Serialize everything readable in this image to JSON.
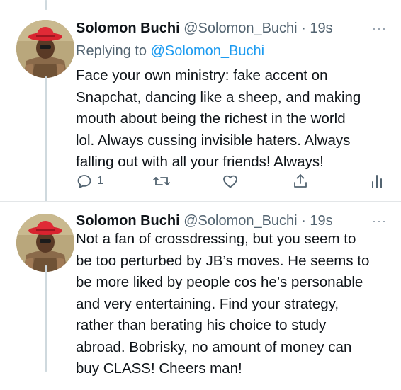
{
  "tweets": [
    {
      "author": {
        "name": "Solomon Buchi",
        "handle": "@Solomon_Buchi",
        "avatar_icon": "profile-avatar"
      },
      "separator": "·",
      "time": "19s",
      "more_icon": "more-icon",
      "replying_prefix": "Replying to",
      "replying_to": "@Solomon_Buchi",
      "text": "Face your own ministry: fake accent on\nSnapchat, dancing like a sheep, and making\nmouth about being the richest in the world\nlol. Always cussing invisible haters. Always\nfalling out with all your friends! Always!",
      "actions": {
        "reply_count": "1",
        "retweet_count": "",
        "like_count": ""
      }
    },
    {
      "author": {
        "name": "Solomon Buchi",
        "handle": "@Solomon_Buchi",
        "avatar_icon": "profile-avatar"
      },
      "separator": "·",
      "time": "19s",
      "more_icon": "more-icon",
      "text": "Not a fan of crossdressing, but you seem to\nbe too perturbed by JB’s moves. He seems to\nbe more liked by people cos he’s personable\nand very entertaining. Find your strategy,\nrather than berating his choice to study\nabroad. Bobrisky, no amount of money can\nbuy CLASS! Cheers man!"
    }
  ],
  "colors": {
    "text": "#0f1419",
    "secondary": "#536471",
    "link": "#1d9bf0",
    "thread_line": "#cfd9de",
    "divider": "#e3e6e8"
  }
}
